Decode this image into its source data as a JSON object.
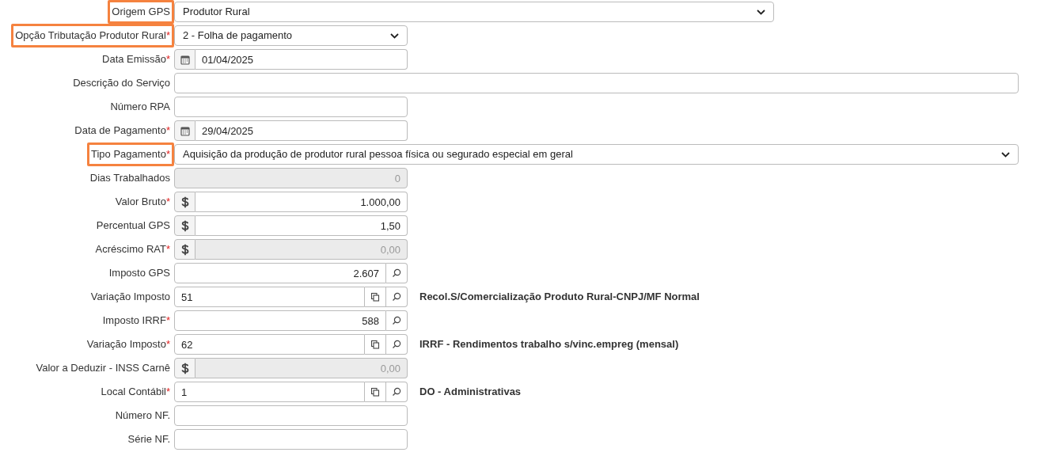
{
  "fields": [
    {
      "label": "Origem GPS",
      "highlighted": true,
      "kind": "select",
      "value": "Produtor Rural",
      "disabled": false
    },
    {
      "label": "Opção Tributação Produtor Rural",
      "required_mark": "*",
      "highlighted": true,
      "kind": "select",
      "value": "2 - Folha de pagamento",
      "disabled": false
    },
    {
      "label": "Data Emissão",
      "required_mark": "*",
      "highlighted": false,
      "kind": "date",
      "value": "01/04/2025",
      "disabled": false
    },
    {
      "label": "Descrição do Serviço",
      "highlighted": false,
      "kind": "text",
      "disabled": false
    },
    {
      "label": "Número RPA",
      "highlighted": false,
      "kind": "text",
      "disabled": false
    },
    {
      "label": "Data de Pagamento",
      "required_mark": "*",
      "highlighted": false,
      "kind": "date",
      "value": "29/04/2025",
      "disabled": false
    },
    {
      "label": "Tipo Pagamento",
      "required_mark": "*",
      "highlighted": true,
      "kind": "select",
      "value": "Aquisição da produção de produtor rural pessoa física ou segurado especial em geral",
      "disabled": false
    },
    {
      "label": "Dias Trabalhados",
      "highlighted": false,
      "kind": "number",
      "value": "0",
      "disabled": true
    },
    {
      "label": "Valor Bruto",
      "required_mark": "*",
      "highlighted": false,
      "kind": "money",
      "value": "1.000,00",
      "disabled": false
    },
    {
      "label": "Percentual GPS",
      "highlighted": false,
      "kind": "money",
      "value": "1,50",
      "disabled": false
    },
    {
      "label": "Acréscimo RAT",
      "required_mark": "*",
      "highlighted": false,
      "kind": "money",
      "value": "0,00",
      "disabled": true
    },
    {
      "label": "Imposto GPS",
      "highlighted": false,
      "kind": "lookup",
      "value": "2.607",
      "disabled": false
    },
    {
      "label": "Variação Imposto",
      "highlighted": false,
      "kind": "code",
      "value": "51",
      "description": "Recol.S/Comercialização Produto Rural-CNPJ/MF Normal",
      "disabled": false
    },
    {
      "label": "Imposto IRRF",
      "required_mark": "*",
      "highlighted": false,
      "kind": "lookup",
      "value": "588",
      "disabled": false
    },
    {
      "label": "Variação Imposto",
      "required_mark": "*",
      "highlighted": false,
      "kind": "code",
      "value": "62",
      "description": "IRRF - Rendimentos trabalho s/vinc.empreg (mensal)",
      "disabled": false
    },
    {
      "label": "Valor a Deduzir - INSS Carnê",
      "highlighted": false,
      "kind": "money",
      "value": "0,00",
      "disabled": true
    },
    {
      "label": "Local Contábil",
      "required_mark": "*",
      "highlighted": false,
      "kind": "code",
      "value": "1",
      "description": "DO - Administrativas",
      "disabled": false
    },
    {
      "label": "Número NF.",
      "highlighted": false,
      "kind": "text",
      "disabled": false
    },
    {
      "label": "Série NF.",
      "highlighted": false,
      "kind": "text",
      "disabled": false
    }
  ]
}
